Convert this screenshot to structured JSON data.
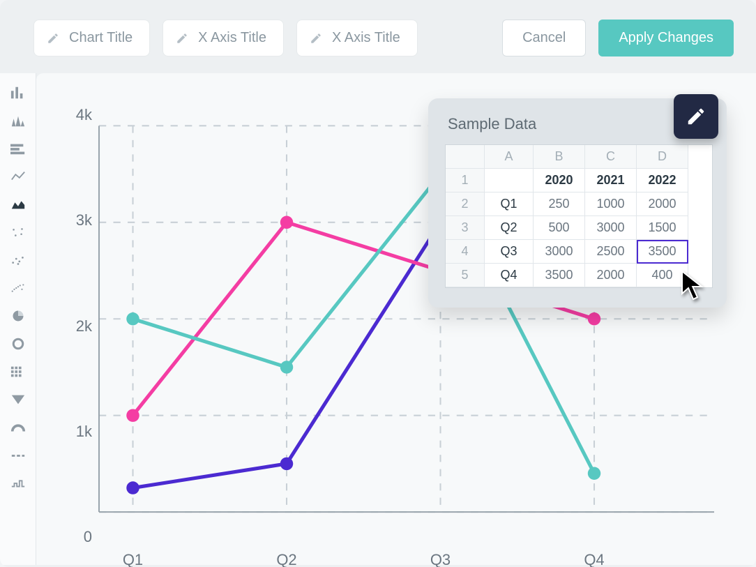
{
  "toolbar": {
    "chart_title_placeholder": "Chart Title",
    "x_axis_placeholder_1": "X Axis Title",
    "x_axis_placeholder_2": "X Axis Title",
    "cancel": "Cancel",
    "apply": "Apply Changes"
  },
  "sidebar": {
    "icons": [
      "bar-chart-icon",
      "histogram-icon",
      "stacked-bar-icon",
      "line-chart-icon",
      "area-chart-icon",
      "scatter-small-icon",
      "scatter-icon",
      "scatter-dense-icon",
      "pie-icon",
      "donut-icon",
      "matrix-icon",
      "funnel-icon",
      "gauge-icon",
      "dash-icon",
      "steps-icon"
    ],
    "active_index": 4
  },
  "popup": {
    "title": "Sample Data",
    "col_letters": [
      "A",
      "B",
      "C",
      "D"
    ],
    "row_numbers": [
      "1",
      "2",
      "3",
      "4",
      "5"
    ],
    "headers": [
      "",
      "2020",
      "2021",
      "2022"
    ],
    "rows": [
      [
        "Q1",
        "250",
        "1000",
        "2000"
      ],
      [
        "Q2",
        "500",
        "3000",
        "1500"
      ],
      [
        "Q3",
        "3000",
        "2500",
        "3500"
      ],
      [
        "Q4",
        "3500",
        "2000",
        "400"
      ]
    ],
    "selected_cell": "3500"
  },
  "yticks": [
    "0",
    "1k",
    "2k",
    "3k",
    "4k"
  ],
  "xticks": [
    "Q1",
    "Q2",
    "Q3",
    "Q4"
  ],
  "chart_data": {
    "type": "line",
    "categories": [
      "Q1",
      "Q2",
      "Q3",
      "Q4"
    ],
    "series": [
      {
        "name": "2020",
        "values": [
          250,
          500,
          3000,
          3500
        ],
        "color": "#4b2ad1"
      },
      {
        "name": "2021",
        "values": [
          1000,
          3000,
          2500,
          2000
        ],
        "color": "#f43da3"
      },
      {
        "name": "2022",
        "values": [
          2000,
          1500,
          3500,
          400
        ],
        "color": "#57c8c1"
      }
    ],
    "xlabel": "",
    "ylabel": "",
    "ylim": [
      0,
      4000
    ],
    "yticks": [
      0,
      1000,
      2000,
      3000,
      4000
    ],
    "title": ""
  },
  "colors": {
    "teal": "#57c8c1",
    "pink": "#f43da3",
    "purple": "#4b2ad1",
    "navy": "#222944"
  }
}
